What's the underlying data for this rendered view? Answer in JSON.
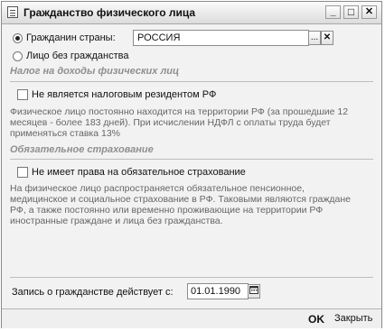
{
  "window": {
    "title": "Гражданство физического лица"
  },
  "titlebar": {
    "minimize": "_",
    "maximize": "□",
    "close": "✕"
  },
  "citizenship": {
    "option1_label": "Гражданин страны:",
    "country_value": "РОССИЯ",
    "select_btn": "...",
    "clear_btn": "✕",
    "option2_label": "Лицо без гражданства"
  },
  "ndfl": {
    "heading": "Налог на доходы физических лиц",
    "checkbox_label": "Не является налоговым резидентом РФ",
    "line1": "Физическое лицо постоянно находится на территории РФ (за прошедшие 12",
    "line2": "месяцев - более 183 дней). При исчислении НДФЛ с оплаты труда будет",
    "line3": "применяться ставка 13%"
  },
  "insurance": {
    "heading": "Обязательное страхование",
    "checkbox_label": "Не имеет права на обязательное страхование",
    "line1": "На физическое лицо распространяется обязательное пенсионное,",
    "line2": "медицинское и социальное страхование в РФ. Таковыми являются граждане",
    "line3": "РФ, а также постоянно или временно проживающие на территории РФ",
    "line4": "иностранные граждане и лица без гражданства."
  },
  "record": {
    "label": "Запись о гражданстве действует с:",
    "date": "01.01.1990"
  },
  "footer": {
    "ok": "OK",
    "close": "Закрыть"
  }
}
